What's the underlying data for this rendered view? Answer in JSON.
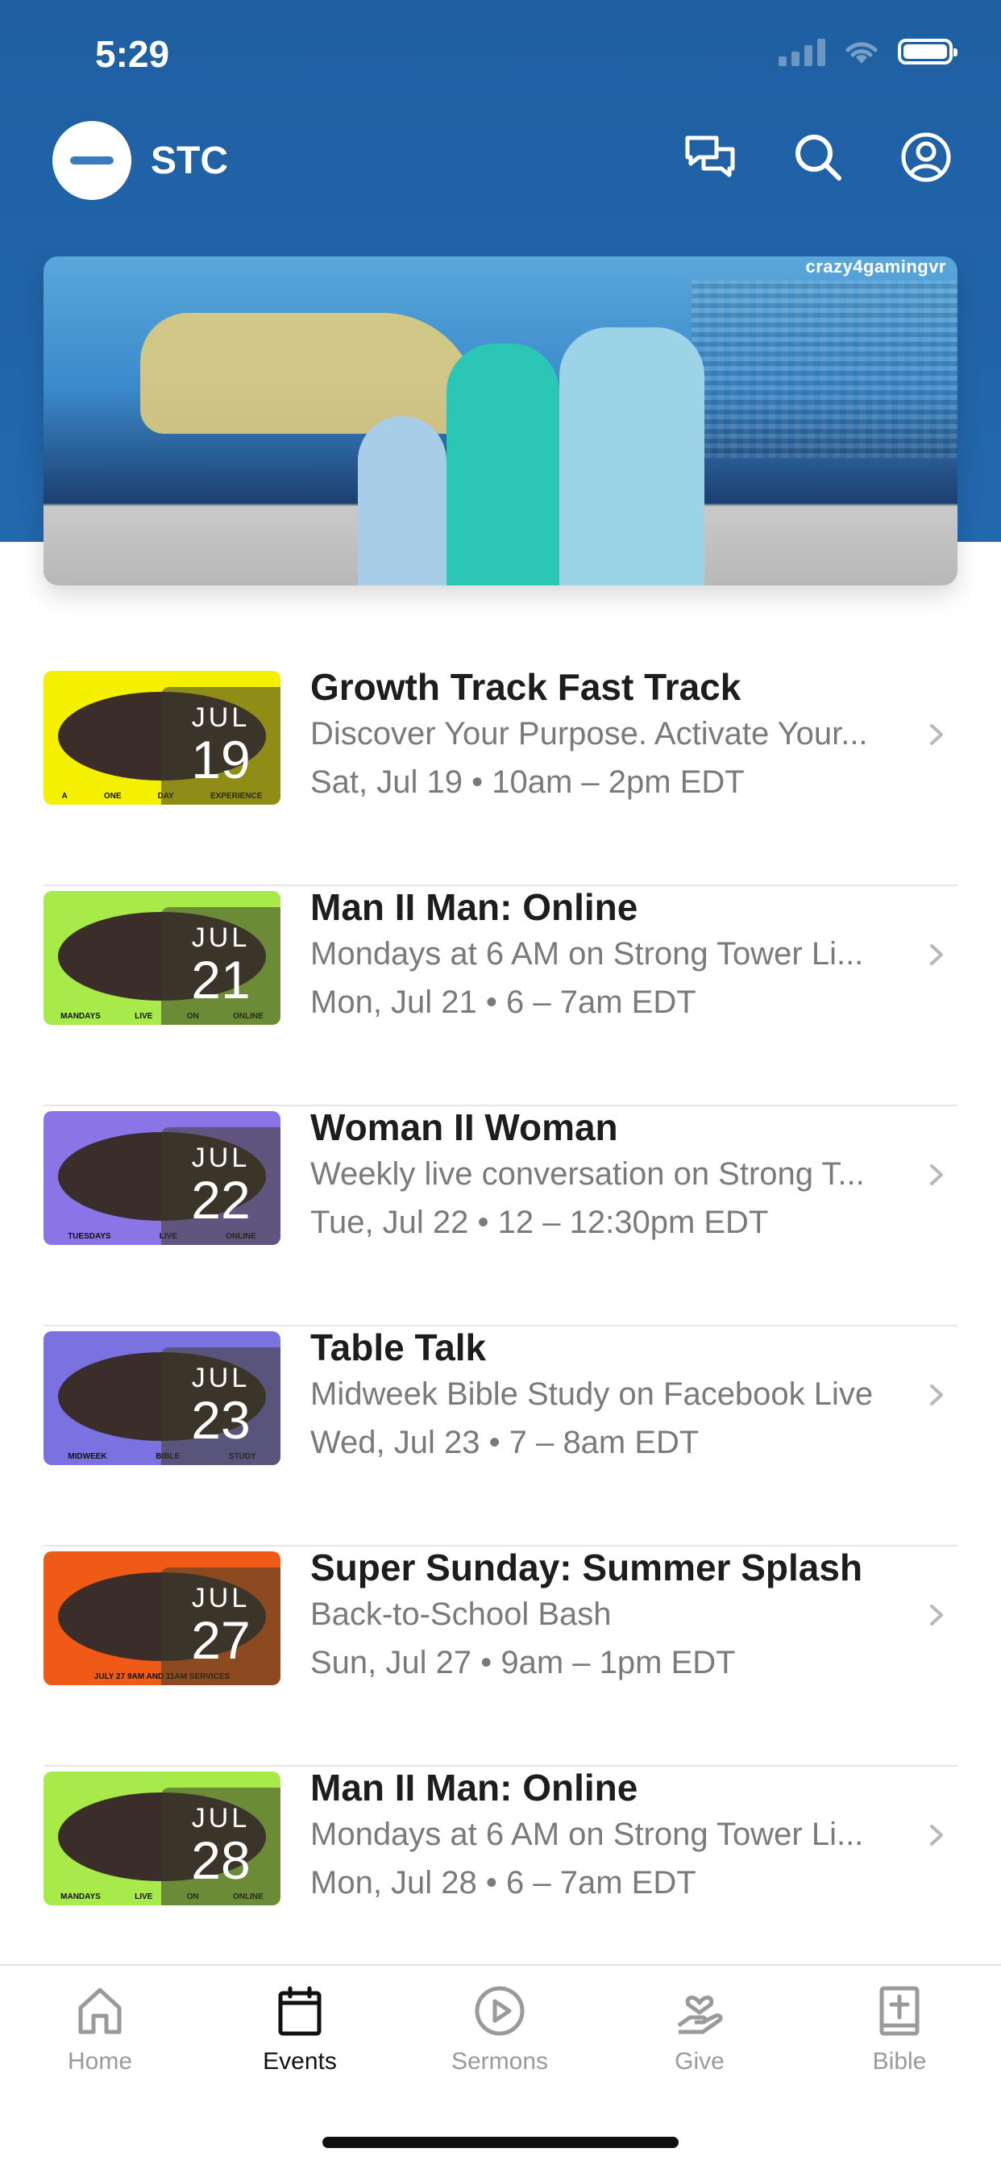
{
  "status_bar": {
    "time": "5:29"
  },
  "app": {
    "name": "STC"
  },
  "header_icons": [
    "chat-icon",
    "search-icon",
    "profile-icon"
  ],
  "banner": {
    "caption": "crazy4gamingvr"
  },
  "events": [
    {
      "month": "JUL",
      "day": "19",
      "title": "Growth Track Fast Track",
      "description": "Discover Your Purpose. Activate Your...",
      "datetime": "Sat, Jul 19 • 10am – 2pm EDT",
      "thumb": {
        "bg": "#f4f000",
        "strip": [
          "A",
          "ONE",
          "DAY",
          "EXPERIENCE"
        ]
      }
    },
    {
      "month": "JUL",
      "day": "21",
      "title": "Man II Man: Online",
      "description": "Mondays at 6 AM on Strong Tower Li...",
      "datetime": "Mon, Jul 21 • 6 – 7am EDT",
      "thumb": {
        "bg": "#a7ea4a",
        "strip": [
          "MANDAYS",
          "LIVE",
          "ON",
          "ONLINE"
        ]
      }
    },
    {
      "month": "JUL",
      "day": "22",
      "title": "Woman II Woman",
      "description": "Weekly live conversation on Strong T...",
      "datetime": "Tue, Jul 22 • 12 – 12:30pm EDT",
      "thumb": {
        "bg": "#8b74e6",
        "strip": [
          "TUESDAYS",
          "LIVE",
          "ONLINE"
        ]
      }
    },
    {
      "month": "JUL",
      "day": "23",
      "title": "Table Talk",
      "description": "Midweek Bible Study on Facebook Live",
      "datetime": "Wed, Jul 23 • 7 – 8am EDT",
      "thumb": {
        "bg": "#7a72e0",
        "strip": [
          "MIDWEEK",
          "BIBLE",
          "STUDY"
        ]
      }
    },
    {
      "month": "JUL",
      "day": "27",
      "title": "Super Sunday: Summer Splash",
      "description": "Back-to-School Bash",
      "datetime": "Sun, Jul 27 • 9am – 1pm EDT",
      "thumb": {
        "bg": "#ef5b17",
        "strip": [
          "JULY 27 9AM AND 11AM SERVICES"
        ]
      }
    },
    {
      "month": "JUL",
      "day": "28",
      "title": "Man II Man: Online",
      "description": "Mondays at 6 AM on Strong Tower Li...",
      "datetime": "Mon, Jul 28 • 6 – 7am EDT",
      "thumb": {
        "bg": "#a7ea4a",
        "strip": [
          "MANDAYS",
          "LIVE",
          "ON",
          "ONLINE"
        ]
      }
    }
  ],
  "tab_bar": {
    "tabs": [
      {
        "label": "Home",
        "icon": "home-icon",
        "active": false
      },
      {
        "label": "Events",
        "icon": "calendar-icon",
        "active": true
      },
      {
        "label": "Sermons",
        "icon": "play-icon",
        "active": false
      },
      {
        "label": "Give",
        "icon": "give-icon",
        "active": false
      },
      {
        "label": "Bible",
        "icon": "bible-icon",
        "active": false
      }
    ]
  },
  "colors": {
    "header": "#2064a8",
    "active_tab": "#111111",
    "inactive_tab": "#9a9a9a"
  }
}
